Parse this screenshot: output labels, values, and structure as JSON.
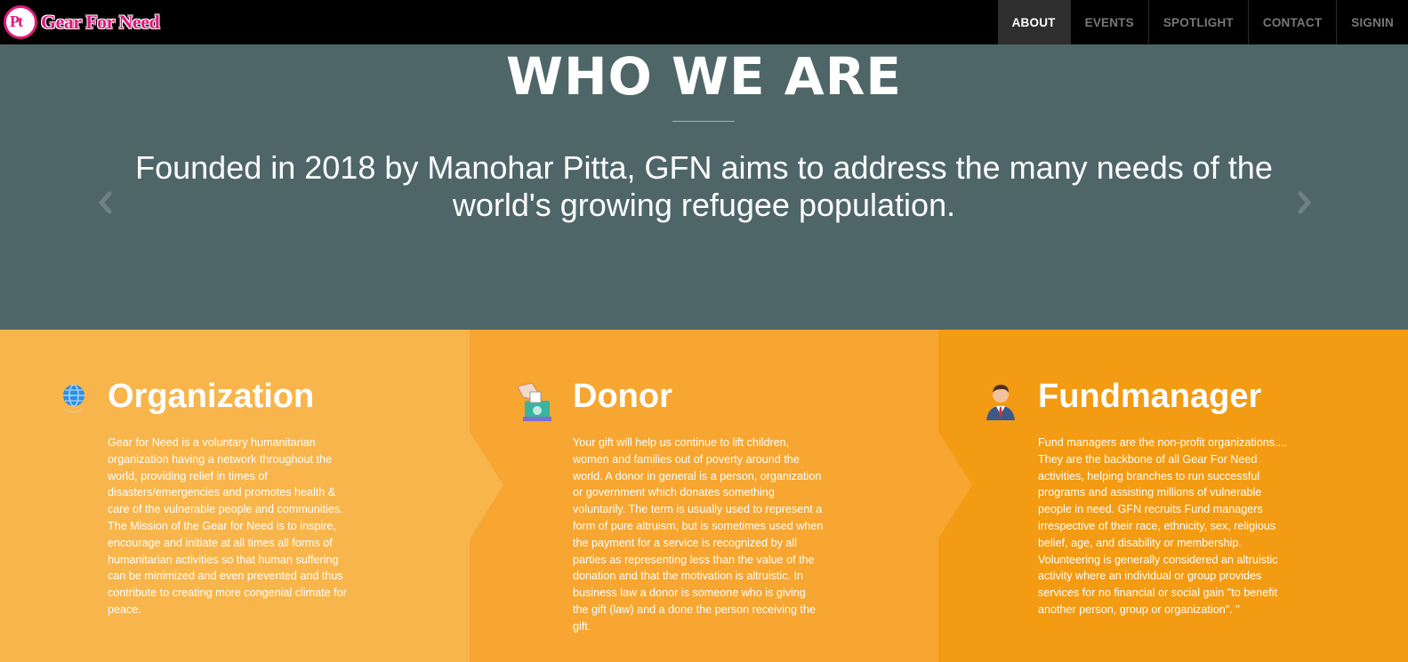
{
  "brand": {
    "mark": "Pt",
    "name": "Gear For Need"
  },
  "nav": {
    "items": [
      {
        "label": "ABOUT",
        "active": true
      },
      {
        "label": "EVENTS",
        "active": false
      },
      {
        "label": "SPOTLIGHT",
        "active": false
      },
      {
        "label": "CONTACT",
        "active": false
      },
      {
        "label": "SIGNIN",
        "active": false
      }
    ]
  },
  "hero": {
    "title": "WHO WE ARE",
    "text": "Founded in 2018 by Manohar Pitta, GFN aims to address the many needs of the world's growing refugee population.",
    "prev_arrow": "‹",
    "next_arrow": "›"
  },
  "features": [
    {
      "icon": "globe-icon",
      "title": "Organization",
      "body": "Gear for Need is a voluntary humanitarian organization having a network throughout the world, providing relief in times of disasters/emergencies and promotes health & care of the vulnerable people and communities. The Mission of the Gear for Need is to inspire, encourage and initiate at all times all forms of humanitarian activities so that human suffering can be minimized and even prevented and thus contribute to creating more congenial climate for peace."
    },
    {
      "icon": "donation-box-icon",
      "title": "Donor",
      "body": "Your gift will help us continue to lift children, women and families out of poverty around the world. A donor in general is a person, organization or government which donates something voluntarily. The term is usually used to represent a form of pure altruism, but is sometimes used when the payment for a service is recognized by all parties as representing less than the value of the donation and that the motivation is altruistic. In business law a donor is someone who is giving the gift (law) and a done the person receiving the gift."
    },
    {
      "icon": "businessman-icon",
      "title": "Fundmanager",
      "body": "Fund managers are the non-profit organizations.... They are the backbone of all Gear For Need activities, helping branches to run successful programs and assisting millions of vulnerable people in need. GFN recruits Fund managers irrespective of their race, ethnicity, sex, religious belief, age, and disability or membership. Volunteering is generally considered an altruistic activity where an individual or group provides services for no financial or social gain \"to benefit another person, group or organization\". \""
    }
  ],
  "colors": {
    "navbar": "#000000",
    "hero": "#4f6669",
    "col1": "#f8b54b",
    "col2": "#f6a631",
    "col3": "#f39b12",
    "brand": "#e0187b"
  }
}
